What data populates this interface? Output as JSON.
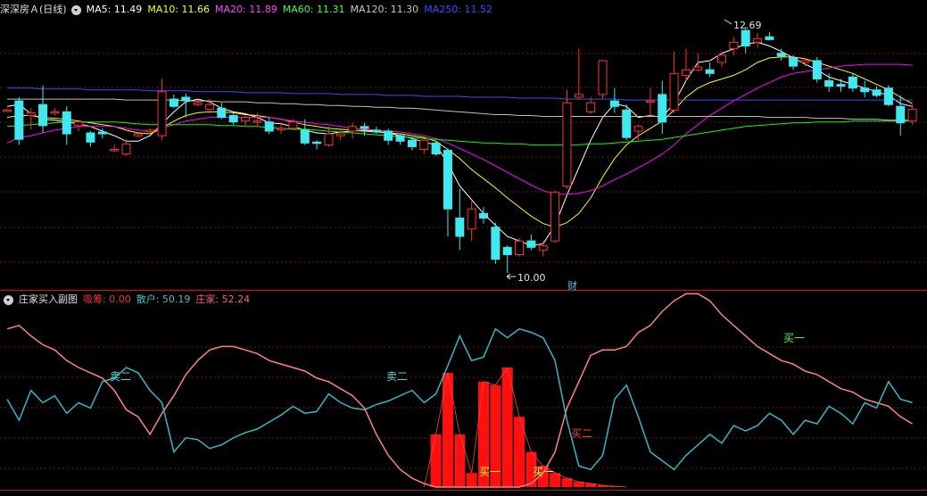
{
  "main": {
    "title": "深深房Ａ(日线)",
    "ma": [
      {
        "label": "MA5: 11.49",
        "color": "#ffffff"
      },
      {
        "label": "MA10: 11.66",
        "color": "#ffff00"
      },
      {
        "label": "MA20: 11.89",
        "color": "#ff00ff"
      },
      {
        "label": "MA60: 11.31",
        "color": "#00ff00"
      },
      {
        "label": "MA120: 11.30",
        "color": "#c0c0c0"
      },
      {
        "label": "MA250: 11.52",
        "color": "#3050ff"
      }
    ],
    "high_label": "12.69",
    "low_label": "10.00",
    "fin_marker": "财"
  },
  "sub": {
    "title": "庄家买入副图",
    "items": [
      {
        "label": "吸筹: 0.00",
        "color": "#ff3030"
      },
      {
        "label": "散户: 50.19",
        "color": "#40c0d0"
      },
      {
        "label": "庄家: 52.24",
        "color": "#ff6060"
      }
    ],
    "annotations": [
      {
        "text": "卖二",
        "color": "#40e0e0"
      },
      {
        "text": "卖二",
        "color": "#40e0e0"
      },
      {
        "text": "买一",
        "color": "#ffff40"
      },
      {
        "text": "买一",
        "color": "#ffff40"
      },
      {
        "text": "买二",
        "color": "#ff4040"
      },
      {
        "text": "买一",
        "color": "#40ff40"
      }
    ]
  },
  "colors": {
    "up": "#ff3030",
    "down": "#40e8f0",
    "grid": "#7a1010",
    "divider": "#a02020"
  },
  "chart_data": {
    "type": "candlestick",
    "price_range": [
      10.0,
      12.69
    ],
    "candles": [
      [
        11.78,
        11.8,
        11.76,
        11.78
      ],
      [
        11.88,
        11.92,
        11.4,
        11.46
      ],
      [
        11.72,
        11.8,
        11.57,
        11.75
      ],
      [
        11.84,
        12.05,
        11.53,
        11.61
      ],
      [
        11.75,
        11.8,
        11.72,
        11.76
      ],
      [
        11.76,
        11.82,
        11.4,
        11.52
      ],
      [
        11.61,
        11.66,
        11.55,
        11.65
      ],
      [
        11.53,
        11.55,
        11.38,
        11.43
      ],
      [
        11.54,
        11.58,
        11.47,
        11.52
      ],
      [
        11.35,
        11.4,
        11.32,
        11.35
      ],
      [
        11.3,
        11.46,
        11.28,
        11.41
      ],
      [
        11.5,
        11.52,
        11.48,
        11.52
      ],
      [
        11.56,
        11.58,
        11.53,
        11.56
      ],
      [
        11.5,
        12.12,
        11.45,
        11.98
      ],
      [
        11.9,
        11.95,
        11.8,
        11.82
      ],
      [
        11.92,
        11.96,
        11.7,
        11.88
      ],
      [
        11.84,
        11.88,
        11.82,
        11.86
      ],
      [
        11.79,
        11.9,
        11.74,
        11.84
      ],
      [
        11.8,
        11.86,
        11.68,
        11.7
      ],
      [
        11.72,
        11.76,
        11.62,
        11.65
      ],
      [
        11.66,
        11.72,
        11.6,
        11.7
      ],
      [
        11.65,
        11.75,
        11.6,
        11.66
      ],
      [
        11.65,
        11.7,
        11.52,
        11.55
      ],
      [
        11.57,
        11.62,
        11.52,
        11.58
      ],
      [
        11.58,
        11.68,
        11.56,
        11.65
      ],
      [
        11.56,
        11.68,
        11.4,
        11.42
      ],
      [
        11.43,
        11.45,
        11.35,
        11.42
      ],
      [
        11.4,
        11.6,
        11.38,
        11.52
      ],
      [
        11.5,
        11.56,
        11.45,
        11.52
      ],
      [
        11.55,
        11.64,
        11.47,
        11.6
      ],
      [
        11.6,
        11.64,
        11.5,
        11.58
      ],
      [
        11.56,
        11.6,
        11.52,
        11.54
      ],
      [
        11.55,
        11.58,
        11.4,
        11.45
      ],
      [
        11.5,
        11.52,
        11.4,
        11.44
      ],
      [
        11.45,
        11.48,
        11.34,
        11.38
      ],
      [
        11.35,
        11.46,
        11.3,
        11.45
      ],
      [
        11.42,
        11.44,
        11.28,
        11.3
      ],
      [
        11.34,
        11.36,
        10.4,
        10.7
      ],
      [
        10.6,
        10.92,
        10.25,
        10.4
      ],
      [
        10.48,
        10.78,
        10.35,
        10.7
      ],
      [
        10.65,
        10.72,
        10.54,
        10.6
      ],
      [
        10.5,
        10.55,
        10.1,
        10.15
      ],
      [
        10.28,
        10.3,
        10.0,
        10.2
      ],
      [
        10.2,
        10.38,
        10.18,
        10.35
      ],
      [
        10.35,
        10.42,
        10.25,
        10.28
      ],
      [
        10.25,
        10.35,
        10.18,
        10.3
      ],
      [
        10.35,
        10.9,
        10.33,
        10.88
      ],
      [
        10.95,
        12.0,
        10.92,
        11.86
      ],
      [
        11.92,
        12.45,
        11.9,
        11.95
      ],
      [
        11.76,
        11.92,
        11.74,
        11.86
      ],
      [
        11.95,
        12.3,
        11.9,
        12.32
      ],
      [
        11.88,
        12.02,
        11.75,
        11.82
      ],
      [
        11.78,
        11.84,
        11.45,
        11.48
      ],
      [
        11.55,
        11.62,
        11.45,
        11.6
      ],
      [
        11.88,
        12.02,
        11.7,
        11.88
      ],
      [
        11.95,
        12.1,
        11.52,
        11.65
      ],
      [
        11.78,
        12.42,
        11.75,
        12.18
      ],
      [
        12.16,
        12.45,
        12.1,
        12.22
      ],
      [
        12.22,
        12.4,
        12.2,
        12.25
      ],
      [
        12.22,
        12.3,
        12.14,
        12.18
      ],
      [
        12.3,
        12.42,
        12.25,
        12.38
      ],
      [
        12.45,
        12.58,
        12.38,
        12.52
      ],
      [
        12.65,
        12.69,
        12.4,
        12.48
      ],
      [
        12.52,
        12.62,
        12.46,
        12.56
      ],
      [
        12.58,
        12.63,
        12.54,
        12.55
      ],
      [
        12.4,
        12.45,
        12.32,
        12.37
      ],
      [
        12.35,
        12.38,
        12.22,
        12.26
      ],
      [
        12.3,
        12.34,
        12.26,
        12.32
      ],
      [
        12.32,
        12.36,
        12.08,
        12.12
      ],
      [
        12.1,
        12.18,
        11.98,
        12.04
      ],
      [
        12.06,
        12.12,
        11.98,
        12.04
      ],
      [
        12.14,
        12.18,
        11.98,
        12.02
      ],
      [
        12.02,
        12.1,
        11.92,
        11.98
      ],
      [
        12.0,
        12.04,
        11.92,
        11.94
      ],
      [
        12.02,
        12.05,
        11.82,
        11.84
      ],
      [
        11.82,
        11.94,
        11.5,
        11.64
      ],
      [
        11.66,
        11.84,
        11.62,
        11.79
      ]
    ],
    "ma_series": [
      {
        "name": "MA5",
        "color": "#ffffff",
        "values": [
          11.82,
          11.84,
          11.74,
          11.68,
          11.67,
          11.65,
          11.63,
          11.6,
          11.55,
          11.5,
          11.44,
          11.44,
          11.5,
          11.63,
          11.76,
          11.87,
          11.9,
          11.87,
          11.8,
          11.76,
          11.74,
          11.7,
          11.64,
          11.63,
          11.6,
          11.56,
          11.53,
          11.52,
          11.54,
          11.55,
          11.56,
          11.55,
          11.53,
          11.5,
          11.47,
          11.43,
          11.4,
          11.2,
          10.95,
          10.8,
          10.65,
          10.52,
          10.4,
          10.35,
          10.3,
          10.32,
          10.52,
          10.85,
          11.15,
          11.45,
          11.7,
          11.85,
          11.82,
          11.7,
          11.72,
          11.7,
          11.86,
          12.1,
          12.3,
          12.32,
          12.4,
          12.45,
          12.5,
          12.52,
          12.48,
          12.42,
          12.35,
          12.28,
          12.22,
          12.14,
          12.1,
          12.06,
          12.02,
          11.98,
          11.94,
          11.85,
          11.82
        ]
      },
      {
        "name": "MA10",
        "color": "#ffff00",
        "values": [
          11.7,
          11.72,
          11.72,
          11.7,
          11.69,
          11.68,
          11.66,
          11.64,
          11.62,
          11.6,
          11.56,
          11.53,
          11.52,
          11.58,
          11.66,
          11.72,
          11.75,
          11.76,
          11.76,
          11.75,
          11.73,
          11.72,
          11.7,
          11.68,
          11.65,
          11.62,
          11.6,
          11.58,
          11.57,
          11.56,
          11.55,
          11.54,
          11.53,
          11.52,
          11.5,
          11.48,
          11.44,
          11.35,
          11.25,
          11.13,
          11.03,
          10.93,
          10.82,
          10.72,
          10.62,
          10.54,
          10.5,
          10.55,
          10.65,
          10.82,
          11.05,
          11.25,
          11.4,
          11.5,
          11.58,
          11.66,
          11.78,
          11.92,
          12.02,
          12.08,
          12.12,
          12.16,
          12.22,
          12.3,
          12.35,
          12.36,
          12.36,
          12.34,
          12.3,
          12.26,
          12.22,
          12.18,
          12.12,
          12.06,
          12.0,
          11.92,
          11.85
        ]
      },
      {
        "name": "MA20",
        "color": "#ff00ff",
        "values": [
          11.42,
          11.48,
          11.5,
          11.53,
          11.56,
          11.58,
          11.6,
          11.6,
          11.6,
          11.6,
          11.58,
          11.56,
          11.55,
          11.58,
          11.62,
          11.66,
          11.68,
          11.7,
          11.7,
          11.7,
          11.7,
          11.7,
          11.7,
          11.68,
          11.66,
          11.65,
          11.63,
          11.62,
          11.6,
          11.58,
          11.57,
          11.56,
          11.55,
          11.54,
          11.52,
          11.5,
          11.47,
          11.42,
          11.36,
          11.3,
          11.24,
          11.17,
          11.1,
          11.03,
          10.96,
          10.9,
          10.86,
          10.86,
          10.87,
          10.9,
          10.95,
          11.02,
          11.08,
          11.15,
          11.22,
          11.3,
          11.4,
          11.52,
          11.62,
          11.72,
          11.8,
          11.88,
          11.95,
          12.02,
          12.08,
          12.14,
          12.18,
          12.2,
          12.22,
          12.24,
          12.26,
          12.27,
          12.28,
          12.28,
          12.28,
          12.28,
          12.27
        ]
      },
      {
        "name": "MA60",
        "color": "#00ff00",
        "values": [
          11.6,
          11.61,
          11.62,
          11.63,
          11.64,
          11.65,
          11.65,
          11.65,
          11.65,
          11.65,
          11.64,
          11.63,
          11.62,
          11.62,
          11.62,
          11.62,
          11.62,
          11.62,
          11.61,
          11.61,
          11.6,
          11.6,
          11.59,
          11.58,
          11.57,
          11.57,
          11.56,
          11.55,
          11.54,
          11.53,
          11.52,
          11.51,
          11.5,
          11.49,
          11.48,
          11.47,
          11.46,
          11.45,
          11.44,
          11.43,
          11.42,
          11.42,
          11.41,
          11.41,
          11.4,
          11.4,
          11.4,
          11.4,
          11.4,
          11.41,
          11.41,
          11.42,
          11.43,
          11.44,
          11.45,
          11.46,
          11.48,
          11.5,
          11.52,
          11.54,
          11.56,
          11.58,
          11.6,
          11.61,
          11.62,
          11.63,
          11.64,
          11.64,
          11.65,
          11.65,
          11.65,
          11.66,
          11.66,
          11.66,
          11.66,
          11.66,
          11.66
        ]
      },
      {
        "name": "MA120",
        "color": "#c0c0c0",
        "values": [
          11.9,
          11.9,
          11.9,
          11.9,
          11.9,
          11.9,
          11.9,
          11.9,
          11.9,
          11.9,
          11.89,
          11.89,
          11.89,
          11.89,
          11.89,
          11.88,
          11.88,
          11.88,
          11.87,
          11.87,
          11.87,
          11.86,
          11.86,
          11.85,
          11.85,
          11.84,
          11.84,
          11.83,
          11.83,
          11.82,
          11.82,
          11.81,
          11.81,
          11.8,
          11.8,
          11.79,
          11.78,
          11.77,
          11.76,
          11.75,
          11.74,
          11.73,
          11.73,
          11.72,
          11.72,
          11.71,
          11.71,
          11.71,
          11.71,
          11.71,
          11.71,
          11.71,
          11.71,
          11.71,
          11.71,
          11.71,
          11.71,
          11.71,
          11.71,
          11.71,
          11.71,
          11.71,
          11.71,
          11.71,
          11.7,
          11.7,
          11.7,
          11.7,
          11.69,
          11.69,
          11.69,
          11.68,
          11.68,
          11.68,
          11.67,
          11.67,
          11.67
        ]
      },
      {
        "name": "MA250",
        "color": "#3050ff",
        "values": [
          12.02,
          12.02,
          12.02,
          12.01,
          12.01,
          12.01,
          12.01,
          12.0,
          12.0,
          12.0,
          12.0,
          12.0,
          11.99,
          11.99,
          11.99,
          11.99,
          11.98,
          11.98,
          11.98,
          11.98,
          11.97,
          11.97,
          11.97,
          11.97,
          11.96,
          11.96,
          11.96,
          11.96,
          11.95,
          11.95,
          11.95,
          11.95,
          11.94,
          11.94,
          11.94,
          11.93,
          11.93,
          11.93,
          11.93,
          11.92,
          11.92,
          11.92,
          11.92,
          11.91,
          11.91,
          11.91,
          11.91,
          11.9,
          11.9,
          11.9,
          11.9,
          11.9,
          11.89,
          11.89,
          11.89,
          11.89,
          11.89,
          11.89,
          11.89,
          11.89,
          11.89,
          11.89,
          11.89,
          11.89,
          11.89,
          11.89,
          11.89,
          11.89,
          11.89,
          11.89,
          11.89,
          11.89,
          11.89,
          11.89,
          11.89,
          11.89,
          11.89
        ]
      }
    ],
    "indicator": {
      "range": [
        0,
        100
      ],
      "retail": [
        50,
        38,
        55,
        48,
        52,
        42,
        48,
        45,
        60,
        62,
        68,
        65,
        55,
        48,
        20,
        28,
        27,
        22,
        24,
        28,
        31,
        33,
        37,
        41,
        46,
        42,
        43,
        53,
        48,
        45,
        44,
        47,
        49,
        52,
        55,
        48,
        53,
        69,
        86,
        72,
        74,
        90,
        85,
        90,
        88,
        85,
        72,
        38,
        12,
        10,
        18,
        50,
        58,
        40,
        20,
        15,
        10,
        18,
        24,
        30,
        25,
        35,
        32,
        35,
        42,
        38,
        30,
        38,
        36,
        46,
        42,
        36,
        48,
        45,
        60,
        50,
        48
      ],
      "dealer": [
        90,
        92,
        86,
        81,
        78,
        72,
        68,
        65,
        62,
        55,
        44,
        40,
        30,
        42,
        52,
        64,
        72,
        78,
        80,
        80,
        78,
        76,
        72,
        70,
        68,
        66,
        62,
        60,
        56,
        52,
        45,
        30,
        18,
        10,
        5,
        2,
        0,
        0,
        0,
        0,
        0,
        0,
        0,
        0,
        2,
        8,
        20,
        45,
        60,
        75,
        78,
        78,
        80,
        88,
        92,
        100,
        106,
        110,
        110,
        106,
        98,
        92,
        86,
        80,
        76,
        72,
        70,
        66,
        64,
        60,
        56,
        54,
        50,
        48,
        46,
        40,
        36
      ],
      "accum": [
        0,
        0,
        0,
        0,
        0,
        0,
        0,
        0,
        0,
        0,
        0,
        0,
        0,
        0,
        0,
        0,
        0,
        0,
        0,
        0,
        0,
        0,
        0,
        0,
        0,
        0,
        0,
        0,
        0,
        0,
        0,
        0,
        0,
        0,
        0,
        0,
        30,
        65,
        30,
        8,
        60,
        58,
        68,
        40,
        20,
        12,
        8,
        5,
        3,
        2,
        1,
        0.5,
        0,
        0,
        0,
        0,
        0,
        0,
        0,
        0,
        0,
        0,
        0,
        0,
        0,
        0,
        0,
        0,
        0,
        0,
        0,
        0,
        0,
        0,
        0,
        0,
        0
      ]
    }
  }
}
